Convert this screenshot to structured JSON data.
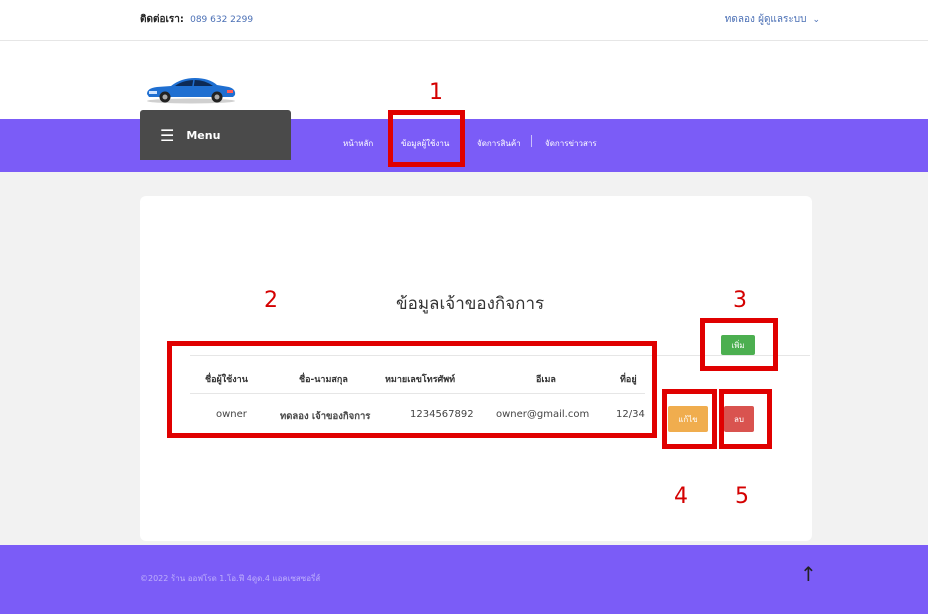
{
  "header": {
    "contact_label": "ติดต่อเรา:",
    "contact_phone": "089 632 2299",
    "user_menu": "ทดลอง ผู้ดูแลระบบ",
    "user_menu_icon": "chevron-down-icon"
  },
  "logo": {
    "icon": "car-icon",
    "car_color": "#1f6fd1"
  },
  "nav": {
    "menu_label": "Menu",
    "menu_icon": "hamburger-icon",
    "items": [
      {
        "label": "หน้าหลัก"
      },
      {
        "label": "ข้อมูลผู้ใช้งาน"
      },
      {
        "label": "จัดการสินค้า"
      },
      {
        "label": "จัดการข่าวสาร"
      }
    ]
  },
  "main": {
    "title": "ข้อมูลเจ้าของกิจการ",
    "add_button": "เพิ่ม",
    "table": {
      "headers": [
        "ชื่อผู้ใช้งาน",
        "ชื่อ-นามสกุล",
        "หมายเลขโทรศัพท์",
        "อีเมล",
        "ที่อยู่"
      ],
      "rows": [
        [
          "owner",
          "ทดลอง เจ้าของกิจการ",
          "1234567892",
          "owner@gmail.com",
          "12/34"
        ]
      ]
    },
    "edit_button": "แก้ไข",
    "delete_button": "ลบ"
  },
  "annotations": [
    "1",
    "2",
    "3",
    "4",
    "5"
  ],
  "footer": {
    "copyright": "©2022 ร้าน ออฟโรด 1.โอ.ฟี 4ดูด.4 แอคเซสซอรี่ส์",
    "back_to_top_icon": "arrow-up-icon"
  },
  "colors": {
    "nav_bg": "#7b5cf7",
    "menu_bg": "#4a4a4a",
    "add": "#4caf50",
    "edit": "#f0ad4e",
    "delete": "#d9534f",
    "annotation": "#e00000"
  }
}
